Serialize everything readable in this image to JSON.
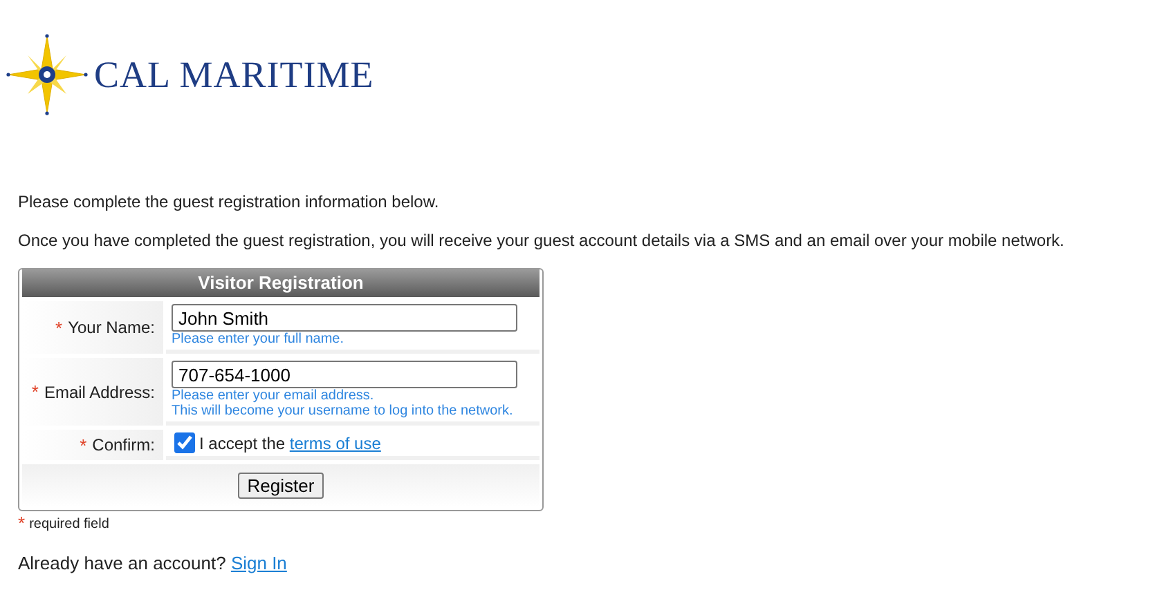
{
  "logo": {
    "text": "CAL MARITIME"
  },
  "intro": [
    "Please complete the guest registration information below.",
    "Once you have completed the guest registration, you will receive your guest account details via a SMS and an email over your mobile network."
  ],
  "form": {
    "title": "Visitor Registration",
    "fields": [
      {
        "kind": "text",
        "marker": "*",
        "label": "Your Name:",
        "value": "John Smith",
        "help": [
          "Please enter your full name."
        ]
      },
      {
        "kind": "text",
        "marker": "*",
        "label": "Email Address:",
        "value": "707-654-1000",
        "help": [
          "Please enter your email address.",
          "This will become your username to log into the network."
        ]
      },
      {
        "kind": "checkbox",
        "marker": "*",
        "label": "Confirm:",
        "checked": true,
        "text": "I accept the ",
        "link": "terms of use"
      }
    ],
    "submit": "Register"
  },
  "legend": {
    "marker": "*",
    "text": "required field"
  },
  "footer": {
    "text": "Already have an account?",
    "link": "Sign In"
  }
}
